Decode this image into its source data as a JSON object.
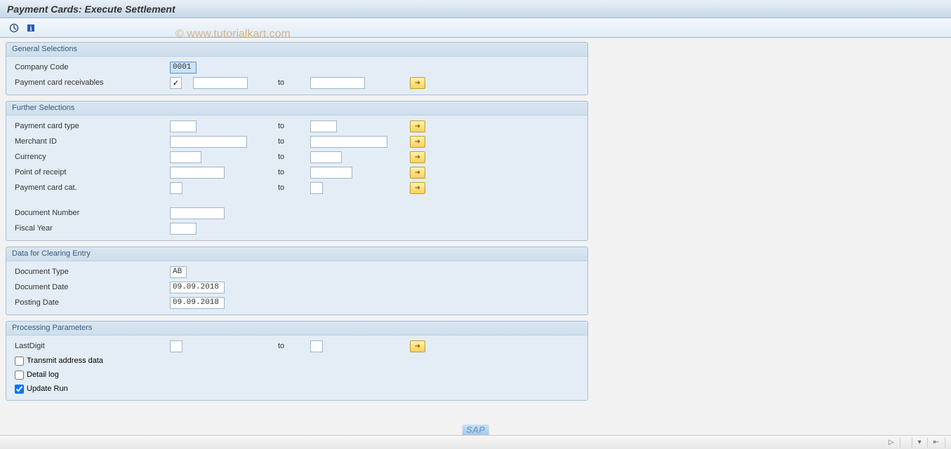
{
  "title": "Payment Cards: Execute Settlement",
  "watermark": "© www.tutorialkart.com",
  "groups": {
    "general": {
      "title": "General Selections",
      "company_code_label": "Company Code",
      "company_code_value": "0001",
      "receivables_label": "Payment card receivables",
      "receivables_checked": true,
      "receivables_from": "",
      "to_label": "to",
      "receivables_to": ""
    },
    "further": {
      "title": "Further Selections",
      "to_label": "to",
      "card_type_label": "Payment card type",
      "card_type_from": "",
      "card_type_to": "",
      "merchant_label": "Merchant ID",
      "merchant_from": "",
      "merchant_to": "",
      "currency_label": "Currency",
      "currency_from": "",
      "currency_to": "",
      "por_label": "Point of receipt",
      "por_from": "",
      "por_to": "",
      "card_cat_label": "Payment card cat.",
      "card_cat_from": "",
      "card_cat_to": "",
      "docnum_label": "Document Number",
      "docnum_value": "",
      "fiscal_label": "Fiscal Year",
      "fiscal_value": ""
    },
    "clearing": {
      "title": "Data for Clearing Entry",
      "doctype_label": "Document Type",
      "doctype_value": "AB",
      "docdate_label": "Document Date",
      "docdate_value": "09.09.2018",
      "postdate_label": "Posting Date",
      "postdate_value": "09.09.2018"
    },
    "processing": {
      "title": "Processing Parameters",
      "to_label": "to",
      "lastdigit_label": "LastDigit",
      "lastdigit_from": "",
      "lastdigit_to": "",
      "transmit_label": "Transmit address data",
      "transmit_checked": false,
      "detaillog_label": "Detail log",
      "detaillog_checked": false,
      "updaterun_label": "Update Run",
      "updaterun_checked": true
    }
  },
  "statusbar": {
    "right": ""
  },
  "sap_logo": "SAP"
}
